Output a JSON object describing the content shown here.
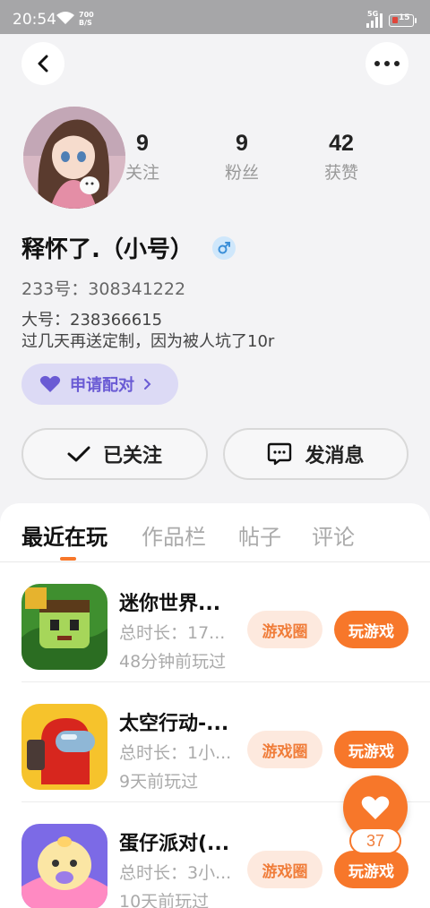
{
  "status_bar": {
    "time": "20:54",
    "net_speed_value": "700",
    "net_speed_unit": "B/S",
    "signal_label": "5G",
    "battery": "15"
  },
  "profile": {
    "stats": [
      {
        "value": "9",
        "label": "关注"
      },
      {
        "value": "9",
        "label": "粉丝"
      },
      {
        "value": "42",
        "label": "获赞"
      }
    ],
    "nickname": "释怀了.（小号）",
    "gender_icon": "male-icon",
    "uid": "233号：308341222",
    "bio_line1": "大号：238366615",
    "bio_line2": "过几天再送定制，因为被人坑了10r",
    "pair_label": "申请配对",
    "follow_label": "已关注",
    "message_label": "发消息"
  },
  "tabs": [
    {
      "label": "最近在玩",
      "active": true
    },
    {
      "label": "作品栏",
      "active": false
    },
    {
      "label": "帖子",
      "active": false
    },
    {
      "label": "评论",
      "active": false
    }
  ],
  "games": [
    {
      "name": "迷你世界...",
      "duration": "总时长：17...",
      "last_played": "48分钟前玩过",
      "circle_label": "游戏圈",
      "play_label": "玩游戏"
    },
    {
      "name": "太空行动-...",
      "duration": "总时长：1小...",
      "last_played": "9天前玩过",
      "circle_label": "游戏圈",
      "play_label": "玩游戏"
    },
    {
      "name": "蛋仔派对(...",
      "duration": "总时长：3小...",
      "last_played": "10天前玩过",
      "circle_label": "游戏圈",
      "play_label": "玩游戏"
    }
  ],
  "like_fab": {
    "count": "37"
  },
  "colors": {
    "accent": "#f7772a",
    "pair_purple": "#6a5bd4",
    "gender_blue": "#3b8fd8"
  }
}
